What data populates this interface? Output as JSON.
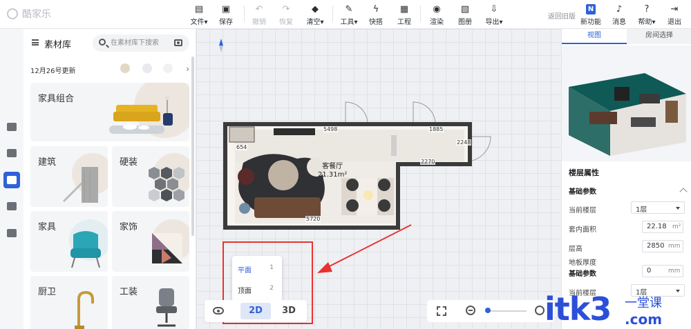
{
  "app": {
    "logo_text": "酷家乐"
  },
  "toolbar": {
    "items": [
      {
        "label": "文件",
        "icon": "file-icon"
      },
      {
        "label": "保存",
        "icon": "save-icon"
      },
      {
        "label": "撤销",
        "icon": "undo-icon"
      },
      {
        "label": "恢复",
        "icon": "redo-icon"
      },
      {
        "label": "清空",
        "icon": "eraser-icon"
      },
      {
        "label": "工具",
        "icon": "wrench-icon"
      },
      {
        "label": "快搭",
        "icon": "bolt-icon"
      },
      {
        "label": "工程",
        "icon": "project-icon"
      },
      {
        "label": "渲染",
        "icon": "render-icon"
      },
      {
        "label": "图册",
        "icon": "album-icon"
      },
      {
        "label": "导出",
        "icon": "export-icon"
      },
      {
        "label": "新功能",
        "icon": "new-feature-icon"
      },
      {
        "label": "消息",
        "icon": "bell-icon"
      },
      {
        "label": "帮助",
        "icon": "help-icon"
      },
      {
        "label": "退出",
        "icon": "logout-icon"
      }
    ],
    "return_old": "返回旧版"
  },
  "material_panel": {
    "title": "素材库",
    "search_placeholder": "在素材库下搜索",
    "update_text": "12月26号更新",
    "featured_card": "家具组合",
    "categories": [
      "建筑",
      "硬装",
      "家具",
      "家饰",
      "厨卫",
      "工装"
    ]
  },
  "canvas": {
    "room_name": "客餐厅",
    "room_area": "21.31m²",
    "dimensions": [
      "5498",
      "1885",
      "654",
      "2248",
      "2270",
      "5720"
    ],
    "popup": [
      {
        "label": "平面",
        "key": "1"
      },
      {
        "label": "顶面",
        "key": "2"
      }
    ],
    "view_2d": "2D",
    "view_3d": "3D"
  },
  "right_panel": {
    "tabs": [
      "视图",
      "房间选择"
    ],
    "section_title": "楼层属性",
    "basic_params": "基础参数",
    "current_floor_label": "当前楼层",
    "current_floor_value": "1层",
    "inner_area_label": "套内面积",
    "inner_area_value": "22.18",
    "inner_area_unit": "m²",
    "height_label": "层高",
    "height_value": "2850",
    "height_unit": "mm",
    "floor_thickness_label": "地板厚度",
    "floor_thickness_value": "0",
    "floor_thickness_unit": "mm",
    "basic_params_2": "基础参数",
    "current_floor_label_2": "当前楼层",
    "current_floor_value_2": "1层"
  },
  "watermark": {
    "main": "itk3",
    "sub1": "一堂课",
    "sub2": ".com"
  },
  "colors": {
    "accent": "#2e62d9",
    "highlight": "#e8322f"
  }
}
